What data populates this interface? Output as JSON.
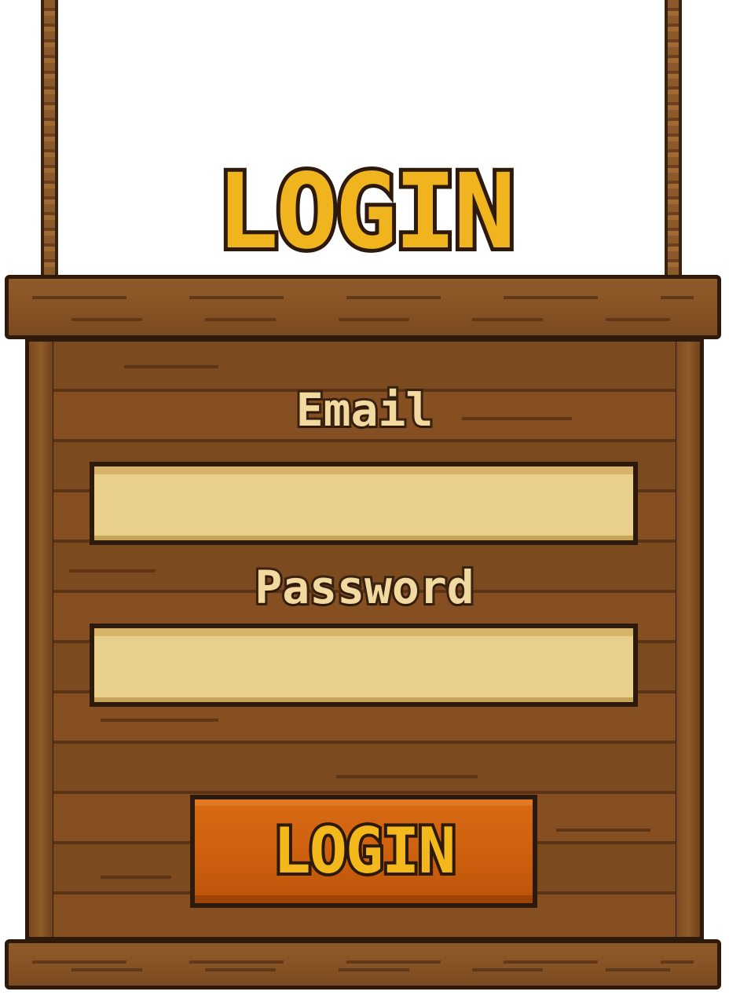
{
  "title": "LOGIN",
  "form": {
    "email_label": "Email",
    "email_value": "",
    "password_label": "Password",
    "password_value": "",
    "submit_label": "LOGIN"
  },
  "colors": {
    "wood": "#7c4a1f",
    "outline": "#2e1a0b",
    "title_gold": "#f0b51e",
    "label_cream": "#f1d9a0",
    "input_fill": "#e8cf8c",
    "button_orange": "#cc5f0e"
  }
}
